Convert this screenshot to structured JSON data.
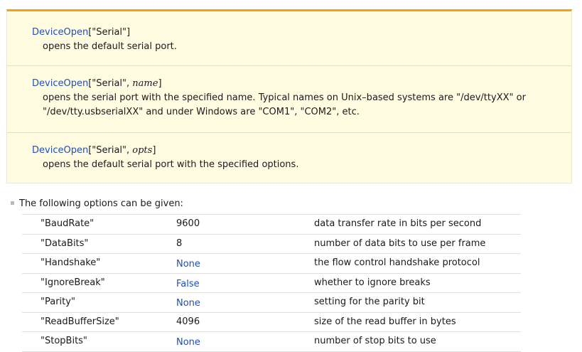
{
  "usages": [
    {
      "function": "DeviceOpen",
      "args_plain": "[\"Serial\"]",
      "args_italic": "",
      "close": "",
      "description_lines": [
        "opens the default serial port."
      ]
    },
    {
      "function": "DeviceOpen",
      "args_plain": "[\"Serial\", ",
      "args_italic": "name",
      "close": "]",
      "description_lines": [
        "opens the serial port with the specified name. Typical names on Unix–based systems are \"/dev/ttyXX\" or",
        "\"/dev/tty.usbserialXX\" and under Windows are \"COM1\", \"COM2\", etc."
      ]
    },
    {
      "function": "DeviceOpen",
      "args_plain": "[\"Serial\", ",
      "args_italic": "opts",
      "close": "]",
      "description_lines": [
        "opens the default serial port with the specified options."
      ]
    }
  ],
  "options_header": "The following options can be given:",
  "options": [
    {
      "name": "\"BaudRate\"",
      "default": "9600",
      "default_is_symbol": false,
      "description": "data transfer rate in bits per second"
    },
    {
      "name": "\"DataBits\"",
      "default": "8",
      "default_is_symbol": false,
      "description": "number of data bits to use per frame"
    },
    {
      "name": "\"Handshake\"",
      "default": "None",
      "default_is_symbol": true,
      "description": "the flow control handshake protocol"
    },
    {
      "name": "\"IgnoreBreak\"",
      "default": "False",
      "default_is_symbol": true,
      "description": "whether to ignore breaks"
    },
    {
      "name": "\"Parity\"",
      "default": "None",
      "default_is_symbol": true,
      "description": "setting for the parity bit"
    },
    {
      "name": "\"ReadBufferSize\"",
      "default": "4096",
      "default_is_symbol": false,
      "description": "size of the read buffer in bytes"
    },
    {
      "name": "\"StopBits\"",
      "default": "None",
      "default_is_symbol": true,
      "description": "number of stop bits to use"
    }
  ],
  "colors": {
    "accent_border": "#f0a30a",
    "usage_background": "#fffce2",
    "link_symbol": "#1e4fb8"
  }
}
